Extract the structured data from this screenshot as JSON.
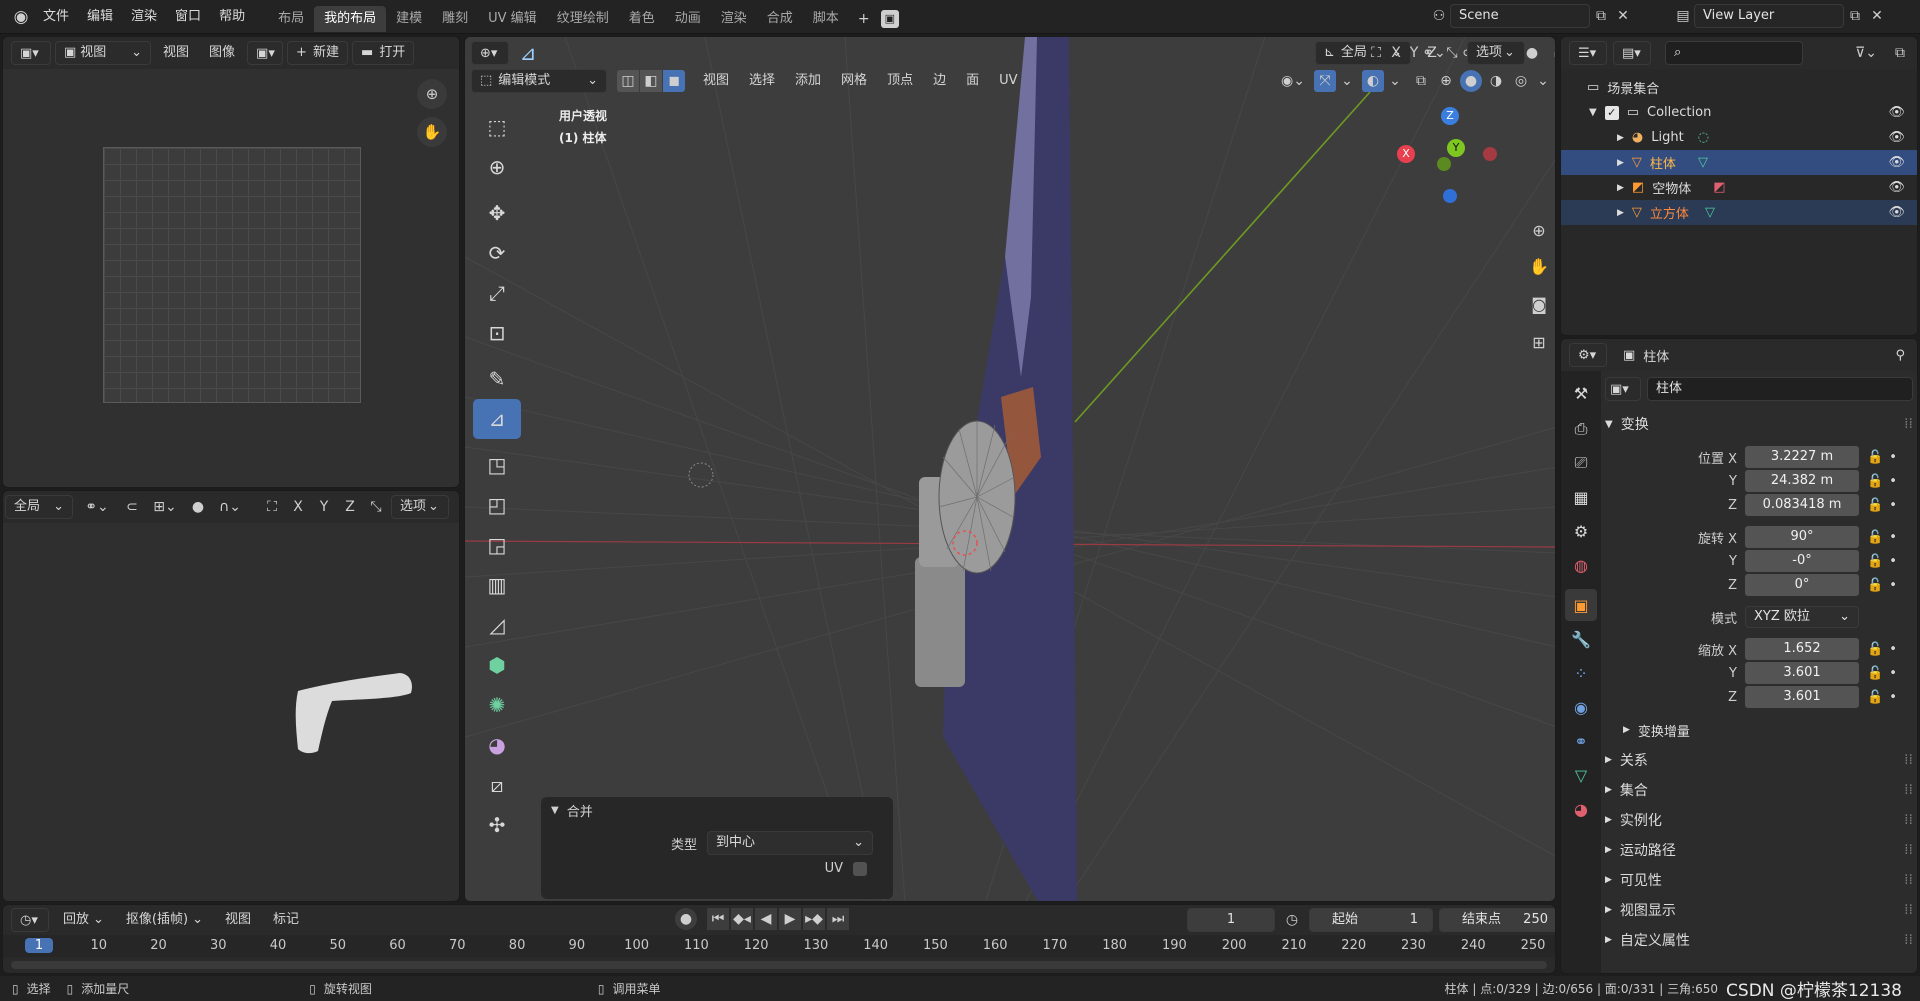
{
  "menu": {
    "file": "文件",
    "edit": "编辑",
    "render": "渲染",
    "window": "窗口",
    "help": "帮助"
  },
  "workspaces": [
    "布局",
    "我的布局",
    "建模",
    "雕刻",
    "UV 编辑",
    "纹理绘制",
    "着色",
    "动画",
    "渲染",
    "合成",
    "脚本"
  ],
  "scene": {
    "name": "Scene",
    "view_layer": "View Layer"
  },
  "image_editor": {
    "view": "视图",
    "view_menu": "视图",
    "image_menu": "图像",
    "new": "新建",
    "open": "打开"
  },
  "left_lower": {
    "orientation": "全局",
    "options": "选项",
    "x": "X",
    "y": "Y",
    "z": "Z"
  },
  "viewport": {
    "mode": "编辑模式",
    "menus": [
      "视图",
      "选择",
      "添加",
      "网格",
      "顶点",
      "边",
      "面",
      "UV"
    ],
    "orientation": "全局",
    "x": "X",
    "y": "Y",
    "z": "Z",
    "options": "选项",
    "overlay_title": "用户透视",
    "overlay_object": "(1) 柱体",
    "gizmo": {
      "x": "X",
      "y": "Y",
      "z": "Z"
    }
  },
  "operator_panel": {
    "title": "合并",
    "type_label": "类型",
    "type_value": "到中心",
    "uv_label": "UV"
  },
  "outliner": {
    "root": "场景集合",
    "items": [
      {
        "name": "Collection",
        "color": "#dcdcdc"
      },
      {
        "name": "Light",
        "color": "#dcdcdc"
      },
      {
        "name": "柱体",
        "color": "#ffb94a"
      },
      {
        "name": "空物体",
        "color": "#dcdcdc"
      },
      {
        "name": "立方体",
        "color": "#ff8a3d"
      }
    ]
  },
  "properties": {
    "object_name": "柱体",
    "data_name": "柱体",
    "transform": "变换",
    "location": {
      "label": "位置 X",
      "x": "3.2227 m",
      "y": "24.382 m",
      "z": "0.083418 m"
    },
    "rotation": {
      "label": "旋转 X",
      "x": "90°",
      "y": "-0°",
      "z": "0°"
    },
    "mode_label": "模式",
    "mode_value": "XYZ 欧拉",
    "scale": {
      "label": "缩放 X",
      "x": "1.652",
      "y": "3.601",
      "z": "3.601"
    },
    "axis_y": "Y",
    "axis_z": "Z",
    "delta": "变换增量",
    "sections": [
      "关系",
      "集合",
      "实例化",
      "运动路径",
      "可见性",
      "视图显示",
      "自定义属性"
    ]
  },
  "timeline": {
    "playback": "回放",
    "keying": "抠像(插帧)",
    "view": "视图",
    "marker": "标记",
    "current_frame": "1",
    "start_label": "起始",
    "start": "1",
    "end_label": "结束点",
    "end": "250",
    "ticks": [
      "1",
      "10",
      "20",
      "30",
      "40",
      "50",
      "60",
      "70",
      "80",
      "90",
      "100",
      "110",
      "120",
      "130",
      "140",
      "150",
      "160",
      "170",
      "180",
      "190",
      "200",
      "210",
      "220",
      "230",
      "240",
      "250"
    ]
  },
  "statusbar": {
    "select": "选择",
    "ruler": "添加量尺",
    "rotate": "旋转视图",
    "menu": "调用菜单",
    "stats": "柱体 | 点:0/329 | 边:0/656 | 面:0/331 | 三角:650",
    "watermark": "CSDN @柠檬茶12138"
  },
  "colors": {
    "accent": "#4772b3",
    "selected_row": "#334d80",
    "axis_x": "#e8404e",
    "axis_y": "#7ec720",
    "axis_z": "#3a7fe0"
  }
}
